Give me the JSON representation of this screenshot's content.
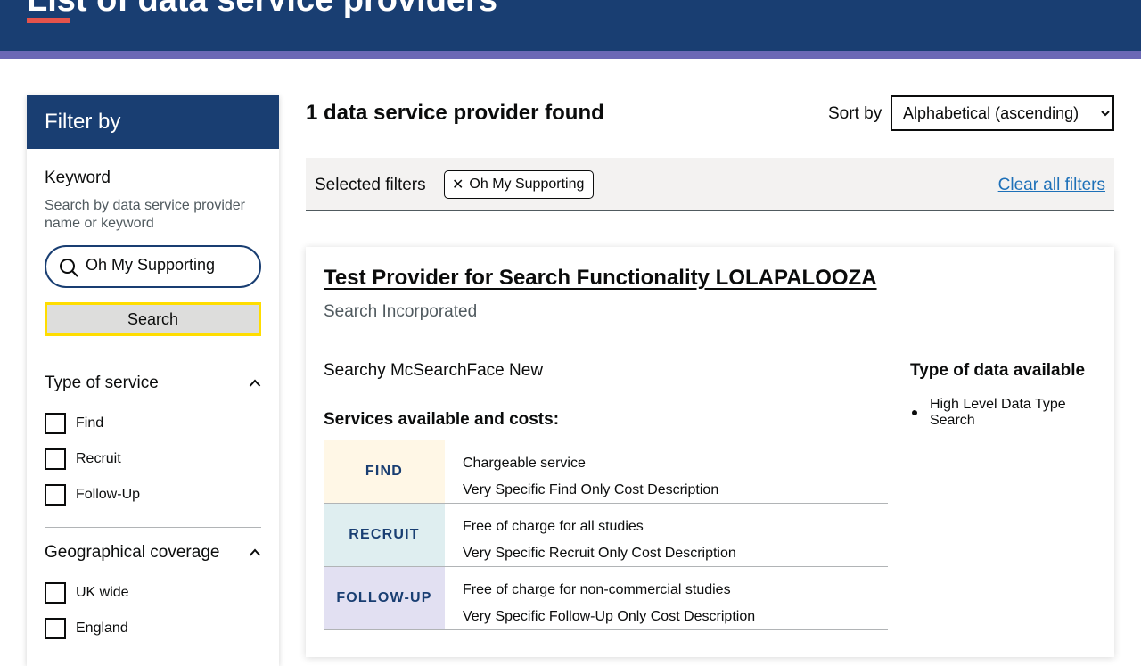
{
  "header": {
    "title": "List of data service providers"
  },
  "sidebar": {
    "heading": "Filter by",
    "keyword": {
      "label": "Keyword",
      "hint": "Search by data service provider name or keyword",
      "value": "Oh My Supporting",
      "button_label": "Search"
    },
    "sections": [
      {
        "title": "Type of service",
        "options": [
          "Find",
          "Recruit",
          "Follow-Up"
        ]
      },
      {
        "title": "Geographical coverage",
        "options": [
          "UK wide",
          "England"
        ]
      }
    ]
  },
  "results": {
    "count_text": "1 data service provider found",
    "sort_label": "Sort by",
    "sort_value": "Alphabetical (ascending)"
  },
  "filters": {
    "label": "Selected filters",
    "chips": [
      "Oh My Supporting"
    ],
    "clear_label": "Clear all filters"
  },
  "provider": {
    "name": "Test Provider for Search Functionality LOLAPALOOZA",
    "organisation": "Search Incorporated",
    "description": "Searchy McSearchFace New",
    "services_heading": "Services available and costs:",
    "services": [
      {
        "tag": "FIND",
        "color": "#fff7e6",
        "charge": "Chargeable service",
        "cost": "Very Specific Find Only Cost Description"
      },
      {
        "tag": "RECRUIT",
        "color": "#dfeef0",
        "charge": "Free of charge for all studies",
        "cost": "Very Specific Recruit Only Cost Description"
      },
      {
        "tag": "FOLLOW-UP",
        "color": "#e2e0f2",
        "charge": "Free of charge for non-commercial studies",
        "cost": "Very Specific Follow-Up Only Cost Description"
      }
    ],
    "data_types_heading": "Type of data available",
    "data_types": [
      "High Level Data Type Search"
    ]
  },
  "colors": {
    "header": "#193e72",
    "stripe": "#6b68b5",
    "accent": "#e5534b",
    "link": "#1d70b8",
    "focus": "#ffdd00"
  },
  "icons": [
    "search-icon",
    "chevron-up-icon",
    "close-icon"
  ]
}
